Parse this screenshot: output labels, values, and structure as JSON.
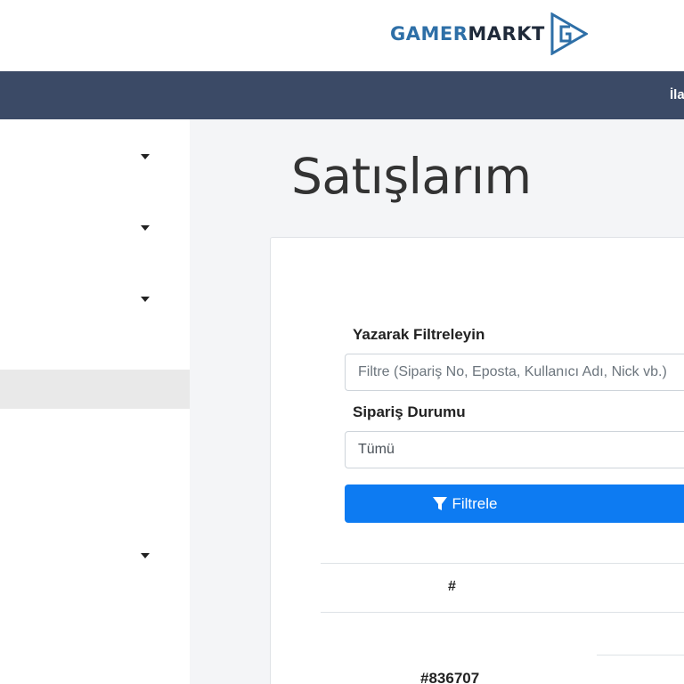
{
  "brand": {
    "part1": "GAMER",
    "part2": "MARKT"
  },
  "navbar": {
    "item_partial": "İla"
  },
  "page": {
    "title": "Satışlarım"
  },
  "filters": {
    "text_label": "Yazarak Filtreleyin",
    "text_placeholder": "Filtre (Sipariş No, Eposta, Kullanıcı Adı, Nick vb.)",
    "status_label": "Sipariş Durumu",
    "status_selected": "Tümü",
    "button_label": "Filtrele"
  },
  "table": {
    "columns": [
      "#"
    ],
    "rows": [
      {
        "id": "#836707"
      }
    ]
  },
  "colors": {
    "navbar": "#3b4a66",
    "primary": "#0d7bf2",
    "brand_blue": "#2e6fa7"
  },
  "icons": {
    "filter": "filter-icon",
    "caret": "caret-down-icon"
  }
}
